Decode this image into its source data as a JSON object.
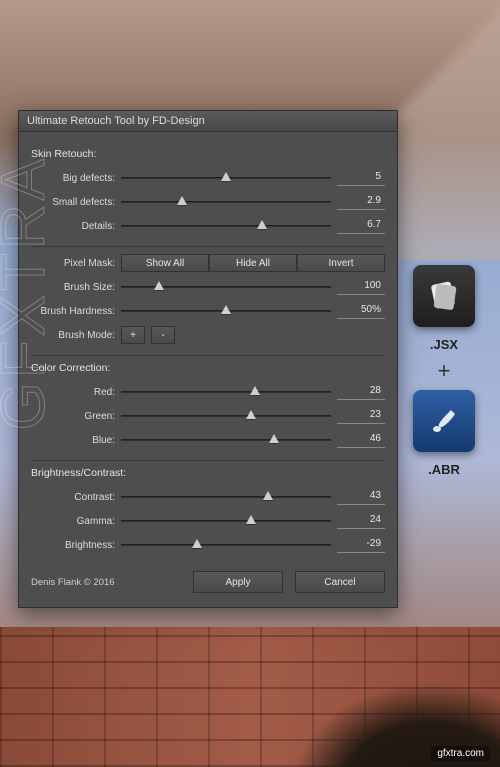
{
  "dialog": {
    "title": "Ultimate Retouch Tool by FD-Design",
    "sections": {
      "skin": {
        "header": "Skin Retouch:",
        "big_defects": {
          "label": "Big defects:",
          "value": "5",
          "pct": 50
        },
        "small_defects": {
          "label": "Small defects:",
          "value": "2.9",
          "pct": 29
        },
        "details": {
          "label": "Details:",
          "value": "6.7",
          "pct": 67
        },
        "pixel_mask": {
          "label": "Pixel Mask:",
          "show_all": "Show All",
          "hide_all": "Hide All",
          "invert": "Invert"
        },
        "brush_size": {
          "label": "Brush Size:",
          "value": "100",
          "pct": 18
        },
        "brush_hardness": {
          "label": "Brush Hardness:",
          "value": "50%",
          "pct": 50
        },
        "brush_mode": {
          "label": "Brush Mode:",
          "plus": "+",
          "minus": "-"
        }
      },
      "color": {
        "header": "Color Correction:",
        "red": {
          "label": "Red:",
          "value": "28",
          "pct": 64
        },
        "green": {
          "label": "Green:",
          "value": "23",
          "pct": 62
        },
        "blue": {
          "label": "Blue:",
          "value": "46",
          "pct": 73
        }
      },
      "bc": {
        "header": "Brightness/Contrast:",
        "contrast": {
          "label": "Contrast:",
          "value": "43",
          "pct": 70
        },
        "gamma": {
          "label": "Gamma:",
          "value": "24",
          "pct": 62
        },
        "brightness": {
          "label": "Brightness:",
          "value": "-29",
          "pct": 36
        }
      }
    },
    "footer": {
      "copyright": "Denis Flank © 2016",
      "apply": "Apply",
      "cancel": "Cancel"
    }
  },
  "files": {
    "jsx_label": ".JSX",
    "plus": "+",
    "abr_label": ".ABR"
  },
  "watermark": "GFXTRA",
  "site_badge": "gfxtra.com"
}
